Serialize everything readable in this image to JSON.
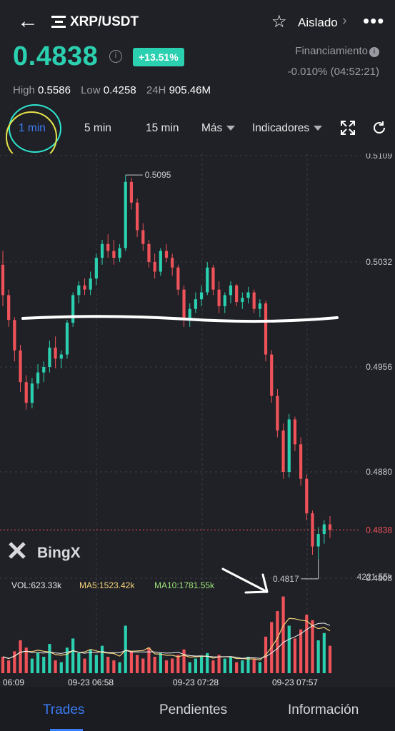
{
  "header": {
    "pair": "XRP/USDT",
    "mode": "Aislado",
    "price": "0.4838",
    "change_pct": "+13.51%",
    "funding_label": "Financiamiento",
    "funding_value": "-0.010% (04:52:21)",
    "stats": {
      "high_label": "High",
      "high_value": "0.5586",
      "low_label": "Low",
      "low_value": "0.4258",
      "vol_label": "24H",
      "vol_value": "905.46M"
    }
  },
  "timeframes": [
    {
      "label": "1 min",
      "active": true
    },
    {
      "label": "5 min"
    },
    {
      "label": "15 min"
    },
    {
      "label": "Más"
    },
    {
      "label": "Indicadores"
    }
  ],
  "icons": [
    "back-arrow-icon",
    "pair-list-icon",
    "star-icon",
    "chevron-right-icon",
    "more-icon",
    "info-icon",
    "fullscreen-icon",
    "refresh-icon"
  ],
  "colors": {
    "up": "#2bd0b0",
    "down": "#f0525a",
    "accent": "#3b7df6",
    "bg": "#202126"
  },
  "chart_data": {
    "type": "candlestick",
    "price_ticks": [
      "0.5109",
      "0.5032",
      "0.4956",
      "0.4880",
      "0.4838",
      "0.4803"
    ],
    "current_price": "0.4838",
    "high_marker": "0.5095",
    "low_marker": "0.4817",
    "ylim": [
      0.4803,
      0.5109
    ],
    "time_labels": [
      "06:09",
      "09-23 06:58",
      "09-23 07:28",
      "09-23 07:57"
    ],
    "watermark": "BingX",
    "volume_legend": {
      "vol": "VOL:623.33k",
      "ma5": "MA5:1523.42k",
      "ma10": "MA10:1781.55k"
    },
    "volume_max_label": "4221.55k",
    "volume_max": 4221.55,
    "candles": [
      [
        0.503,
        0.504,
        0.5,
        0.5008
      ],
      [
        0.5008,
        0.5012,
        0.4985,
        0.499
      ],
      [
        0.499,
        0.4992,
        0.496,
        0.4968
      ],
      [
        0.4968,
        0.4972,
        0.4938,
        0.4945
      ],
      [
        0.4945,
        0.495,
        0.4925,
        0.493
      ],
      [
        0.493,
        0.4948,
        0.4926,
        0.4944
      ],
      [
        0.4944,
        0.4958,
        0.494,
        0.4952
      ],
      [
        0.4952,
        0.496,
        0.4945,
        0.4956
      ],
      [
        0.4956,
        0.4975,
        0.4952,
        0.497
      ],
      [
        0.497,
        0.4978,
        0.4955,
        0.4962
      ],
      [
        0.4962,
        0.4968,
        0.4955,
        0.4965
      ],
      [
        0.4965,
        0.499,
        0.4962,
        0.4988
      ],
      [
        0.4988,
        0.501,
        0.4985,
        0.5008
      ],
      [
        0.5008,
        0.5018,
        0.5002,
        0.5015
      ],
      [
        0.5015,
        0.502,
        0.5008,
        0.5012
      ],
      [
        0.5012,
        0.5025,
        0.5008,
        0.502
      ],
      [
        0.502,
        0.5038,
        0.5015,
        0.5035
      ],
      [
        0.5035,
        0.5048,
        0.503,
        0.5045
      ],
      [
        0.5045,
        0.5052,
        0.5035,
        0.504
      ],
      [
        0.504,
        0.5048,
        0.503,
        0.5035
      ],
      [
        0.5035,
        0.5045,
        0.5032,
        0.5042
      ],
      [
        0.5042,
        0.5095,
        0.504,
        0.509
      ],
      [
        0.509,
        0.5093,
        0.507,
        0.5075
      ],
      [
        0.5075,
        0.5078,
        0.505,
        0.5055
      ],
      [
        0.5055,
        0.506,
        0.504,
        0.5045
      ],
      [
        0.5045,
        0.5048,
        0.5028,
        0.5032
      ],
      [
        0.5032,
        0.5038,
        0.502,
        0.5025
      ],
      [
        0.5025,
        0.5042,
        0.5022,
        0.504
      ],
      [
        0.504,
        0.5045,
        0.5032,
        0.5035
      ],
      [
        0.5035,
        0.5038,
        0.5022,
        0.5028
      ],
      [
        0.5028,
        0.503,
        0.5008,
        0.5012
      ],
      [
        0.5012,
        0.5015,
        0.4985,
        0.499
      ],
      [
        0.499,
        0.5002,
        0.4985,
        0.4998
      ],
      [
        0.4998,
        0.501,
        0.4995,
        0.5005
      ],
      [
        0.5005,
        0.5015,
        0.5,
        0.501
      ],
      [
        0.501,
        0.5032,
        0.5008,
        0.5028
      ],
      [
        0.5028,
        0.503,
        0.5008,
        0.5012
      ],
      [
        0.5012,
        0.5018,
        0.4995,
        0.5
      ],
      [
        0.5,
        0.501,
        0.4995,
        0.5008
      ],
      [
        0.5008,
        0.5018,
        0.5002,
        0.5015
      ],
      [
        0.5015,
        0.5016,
        0.5,
        0.5003
      ],
      [
        0.5003,
        0.501,
        0.4998,
        0.5006
      ],
      [
        0.5006,
        0.5014,
        0.5002,
        0.501
      ],
      [
        0.501,
        0.5012,
        0.4995,
        0.4998
      ],
      [
        0.4998,
        0.5005,
        0.4992,
        0.5002
      ],
      [
        0.5002,
        0.5004,
        0.496,
        0.4965
      ],
      [
        0.4965,
        0.4968,
        0.493,
        0.4935
      ],
      [
        0.4935,
        0.494,
        0.4905,
        0.491
      ],
      [
        0.491,
        0.4915,
        0.4875,
        0.488
      ],
      [
        0.488,
        0.4922,
        0.4876,
        0.4918
      ],
      [
        0.4918,
        0.492,
        0.4895,
        0.49
      ],
      [
        0.49,
        0.4905,
        0.487,
        0.4875
      ],
      [
        0.4875,
        0.4878,
        0.4845,
        0.485
      ],
      [
        0.485,
        0.4852,
        0.482,
        0.4826
      ],
      [
        0.4826,
        0.484,
        0.4817,
        0.4835
      ],
      [
        0.4835,
        0.4845,
        0.4828,
        0.4842
      ],
      [
        0.4842,
        0.4848,
        0.4832,
        0.4838
      ]
    ],
    "volumes": [
      0.9,
      0.7,
      1.2,
      1.8,
      1.4,
      0.8,
      1.1,
      0.9,
      1.6,
      0.7,
      0.6,
      1.4,
      1.9,
      1.1,
      0.8,
      1.3,
      1.0,
      1.5,
      0.9,
      0.7,
      0.6,
      2.6,
      1.2,
      1.0,
      0.8,
      1.4,
      0.9,
      1.1,
      0.7,
      0.8,
      1.0,
      1.3,
      0.6,
      0.8,
      0.9,
      1.1,
      0.7,
      1.0,
      0.8,
      0.9,
      0.6,
      0.7,
      0.9,
      0.8,
      0.6,
      2.0,
      2.8,
      3.4,
      4.2,
      2.6,
      1.9,
      2.4,
      3.2,
      2.9,
      1.8,
      2.2,
      1.5
    ]
  },
  "bottom_tabs": [
    {
      "label": "Trades",
      "active": true
    },
    {
      "label": "Pendientes"
    },
    {
      "label": "Información"
    }
  ]
}
